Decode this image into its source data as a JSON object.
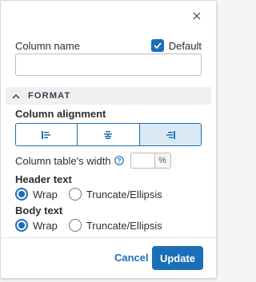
{
  "dialog": {
    "close_icon": "close-icon"
  },
  "column_name": {
    "label": "Column name",
    "value": "",
    "default_label": "Default",
    "default_checked": true
  },
  "format_section": {
    "title": "FORMAT",
    "expanded": true,
    "column_alignment": {
      "label": "Column alignment",
      "options": [
        "left",
        "center",
        "right"
      ],
      "selected": "right"
    },
    "table_width": {
      "label": "Column table's width",
      "value": "",
      "unit": "%"
    },
    "header_text": {
      "label": "Header text",
      "options": [
        "Wrap",
        "Truncate/Ellipsis"
      ],
      "selected": "Wrap"
    },
    "body_text": {
      "label": "Body text",
      "options": [
        "Wrap",
        "Truncate/Ellipsis"
      ],
      "selected": "Wrap"
    }
  },
  "footer": {
    "cancel_label": "Cancel",
    "update_label": "Update"
  },
  "colors": {
    "accent": "#1a6fb8",
    "section_bg": "#eef1f4",
    "active_align_bg": "#dbe9f6"
  }
}
